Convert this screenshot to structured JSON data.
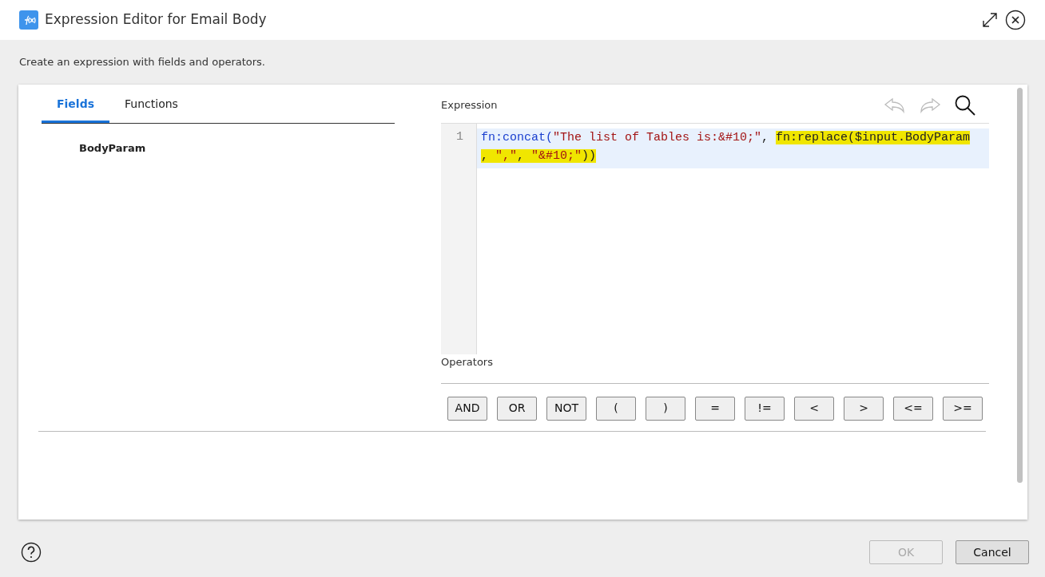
{
  "window": {
    "title": "Expression Editor for Email Body"
  },
  "description": "Create an expression with fields and operators.",
  "tabs": [
    {
      "label": "Fields",
      "selected": true
    },
    {
      "label": "Functions",
      "selected": false
    }
  ],
  "fields": [
    {
      "label": "BodyParam"
    }
  ],
  "expression": {
    "label": "Expression",
    "lines": [
      {
        "number": "1",
        "selected": true,
        "wrapped_parts": [
          {
            "tokens": [
              {
                "text": "fn:concat(",
                "kind": "function",
                "highlighted": false
              },
              {
                "text": "\"The list of Tables is:&#10;\"",
                "kind": "string",
                "highlighted": false
              },
              {
                "text": ", ",
                "kind": "plain",
                "highlighted": false
              },
              {
                "text": "fn:replace($input.BodyParam",
                "kind": "plain",
                "highlighted": true
              }
            ]
          },
          {
            "tokens": [
              {
                "text": ", ",
                "kind": "plain",
                "highlighted": true
              },
              {
                "text": "\",\"",
                "kind": "string",
                "highlighted": true
              },
              {
                "text": ", ",
                "kind": "plain",
                "highlighted": true
              },
              {
                "text": "\"&#10;\"",
                "kind": "string",
                "highlighted": true
              },
              {
                "text": "))",
                "kind": "plain",
                "highlighted": true
              }
            ]
          }
        ]
      }
    ]
  },
  "operators": {
    "label": "Operators",
    "buttons": [
      "AND",
      "OR",
      "NOT",
      "(",
      ")",
      "=",
      "!=",
      "<",
      ">",
      "<=",
      ">="
    ]
  },
  "footer": {
    "buttons": [
      {
        "label": "OK",
        "disabled": true
      },
      {
        "label": "Cancel",
        "disabled": false
      }
    ]
  }
}
